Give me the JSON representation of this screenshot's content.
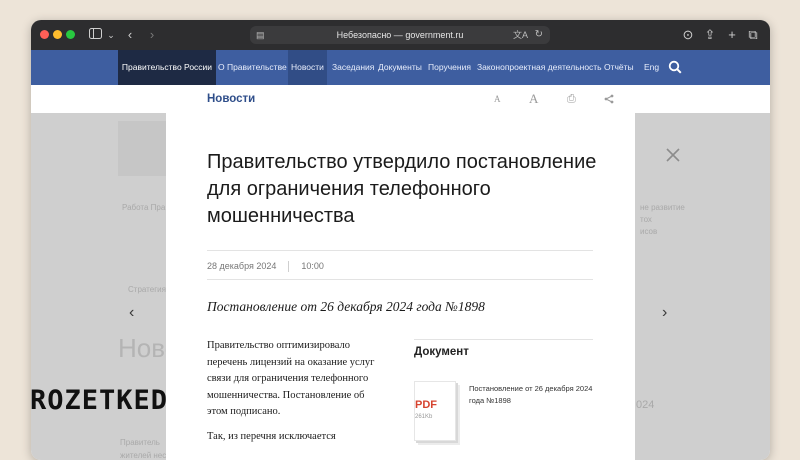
{
  "browser": {
    "url_prefix": "Небезопасно — ",
    "url_domain": "government.ru"
  },
  "nav": {
    "brand": "Правительство России",
    "items": [
      {
        "label": "О Правительстве",
        "active": false
      },
      {
        "label": "Новости",
        "active": true
      },
      {
        "label": "Заседания",
        "active": false
      },
      {
        "label": "Документы",
        "active": false
      },
      {
        "label": "Поручения",
        "active": false
      },
      {
        "label": "Законопроектная деятельность",
        "active": false
      },
      {
        "label": "Отчёты",
        "active": false
      },
      {
        "label": "Eng",
        "active": false
      }
    ]
  },
  "subbar": {
    "title": "Новости",
    "font_small": "A",
    "font_large": "A"
  },
  "background": {
    "big_title": "Ново",
    "snippet_left": "Работа Пра",
    "snippet_right_1": "не развитие",
    "snippet_right_2": "тох",
    "snippet_right_3": "исов",
    "snippet_left_2": "Стратегия",
    "snippet_bottom_1": "Правитель",
    "snippet_bottom_2": "жителей нес",
    "snippet_year": "024"
  },
  "article": {
    "title": "Правительство утвердило постановление для ограничения телефонного мошенничества",
    "date": "28 декабря 2024",
    "time": "10:00",
    "decree": "Постановление от 26 декабря 2024 года №1898",
    "paragraph_1": "Правительство оптимизировало перечень лицензий на оказание услуг связи для ограничения телефонного мошенничества. Постановление об этом подписано.",
    "paragraph_2": "Так, из перечня исключается",
    "document": {
      "heading": "Документ",
      "format": "PDF",
      "size": "261Kb",
      "name": "Постановление от 26 декабря 2024 года №1898"
    }
  },
  "watermark": "ROZETKED"
}
